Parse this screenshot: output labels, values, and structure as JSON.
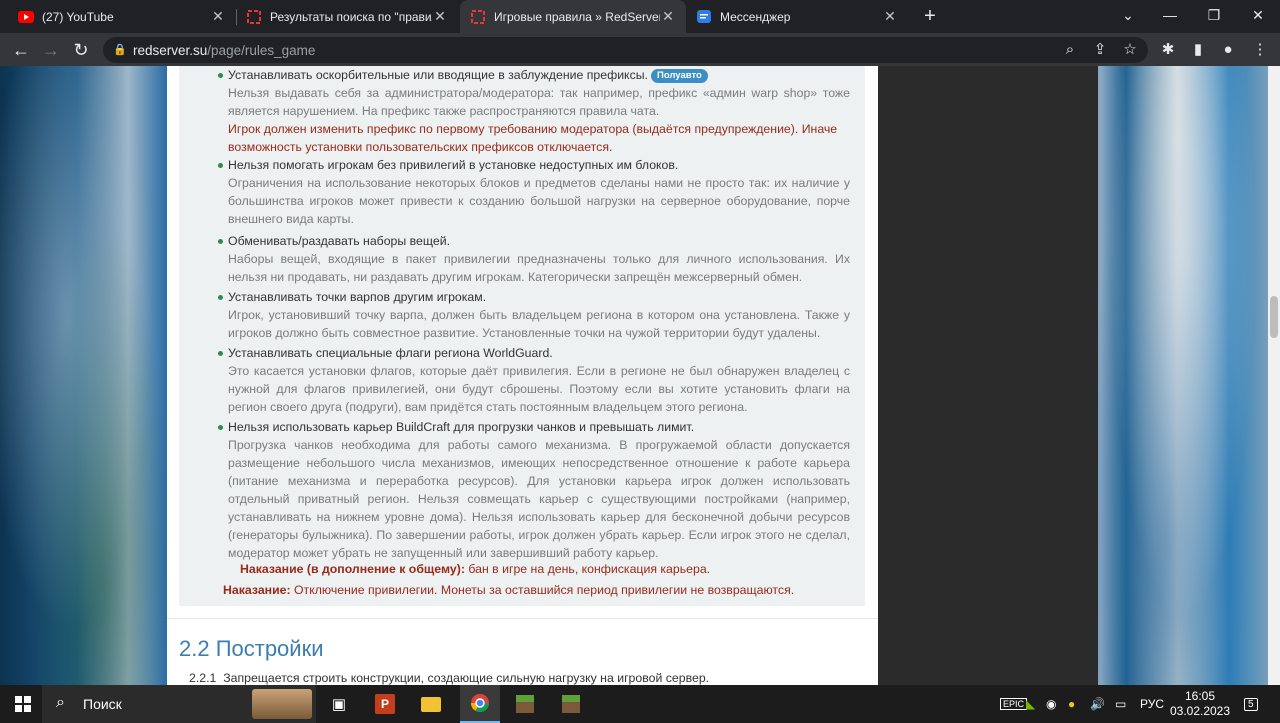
{
  "tabs": [
    {
      "title": "(27) YouTube",
      "icon": "youtube-icon",
      "active": false
    },
    {
      "title": "Результаты поиска по \"правила",
      "icon": "redserver-icon",
      "active": false
    },
    {
      "title": "Игровые правила » RedServer –",
      "icon": "redserver-icon",
      "active": true
    },
    {
      "title": "Мессенджер",
      "icon": "messenger-icon",
      "active": false
    }
  ],
  "address_bar": {
    "host": "redserver.su",
    "path": "/page/rules_game"
  },
  "rules": [
    {
      "head": "Устанавливать оскорбительные или вводящие в заблуждение префиксы.",
      "badge": "Полуавто",
      "desc": "Нельзя выдавать себя за администратора/модератора: так например, префикс «админ warp shop» тоже является нарушением. На префикс также распространяются правила чата.",
      "warn": "Игрок должен изменить префикс по первому требованию модератора (выдаётся предупреждение). Иначе возможность установки пользовательских префиксов отключается."
    },
    {
      "head": "Нельзя помогать игрокам без привилегий в установке недоступных им блоков.",
      "desc": "Ограничения на использование некоторых блоков и предметов сделаны нами не просто так: их наличие у большинства игроков может привести к созданию большой нагрузки на серверное оборудование, порче внешнего вида карты."
    },
    {
      "head": "Обменивать/раздавать наборы вещей.",
      "desc": "Наборы вещей, входящие в пакет привилегии предназначены только для личного использования. Их нельзя ни продавать, ни раздавать другим игрокам. Категорически запрещён межсерверный обмен."
    },
    {
      "head": "Устанавливать точки варпов другим игрокам.",
      "desc": "Игрок, установивший точку варпа, должен быть владельцем региона в котором она установлена. Также у игроков должно быть совместное развитие. Установленные точки на чужой территории будут удалены."
    },
    {
      "head": "Устанавливать специальные флаги региона WorldGuard.",
      "desc": "Это касается установки флагов, которые даёт привилегия. Если в регионе не был обнаружен владелец с нужной для флагов привилегией, они будут сброшены. Поэтому если вы хотите установить флаги на регион своего друга (подруги), вам придётся стать постоянным владельцем этого региона."
    },
    {
      "head": "Нельзя использовать карьер BuildCraft для прогрузки чанков и превышать лимит.",
      "desc": "Прогрузка чанков необходима для работы самого механизма. В прогружаемой области допускается размещение небольшого числа механизмов, имеющих непосредственное отношение к работе карьера (питание механизма и переработка ресурсов). Для установки карьера игрок должен использовать отдельный приватный регион. Нельзя совмещать карьер с существующими постройками (например, устанавливать на нижнем уровне дома). Нельзя использовать карьер для бесконечной добычи ресурсов (генераторы булыжника). По завершении работы, игрок должен убрать карьер. Если игрок этого не сделал, модератор может убрать не запущенный или завершивший работу карьер."
    }
  ],
  "penalty": {
    "label": "Наказание (в дополнение к общему):",
    "text": " бан в игре на день, конфискация карьера."
  },
  "global_penalty": {
    "label": "Наказание:",
    "text": " Отключение привилегии. Монеты за оставшийся период привилегии не возвращаются."
  },
  "section": {
    "title": "2.2 Постройки",
    "sub_number": "2.2.1",
    "sub_text": "Запрещается строить конструкции, создающие сильную нагрузку на игровой сервер."
  },
  "taskbar": {
    "search_label": "Поиск",
    "lang": "РУС",
    "time": "16:05",
    "date": "03.02.2023",
    "notifications": "5"
  }
}
